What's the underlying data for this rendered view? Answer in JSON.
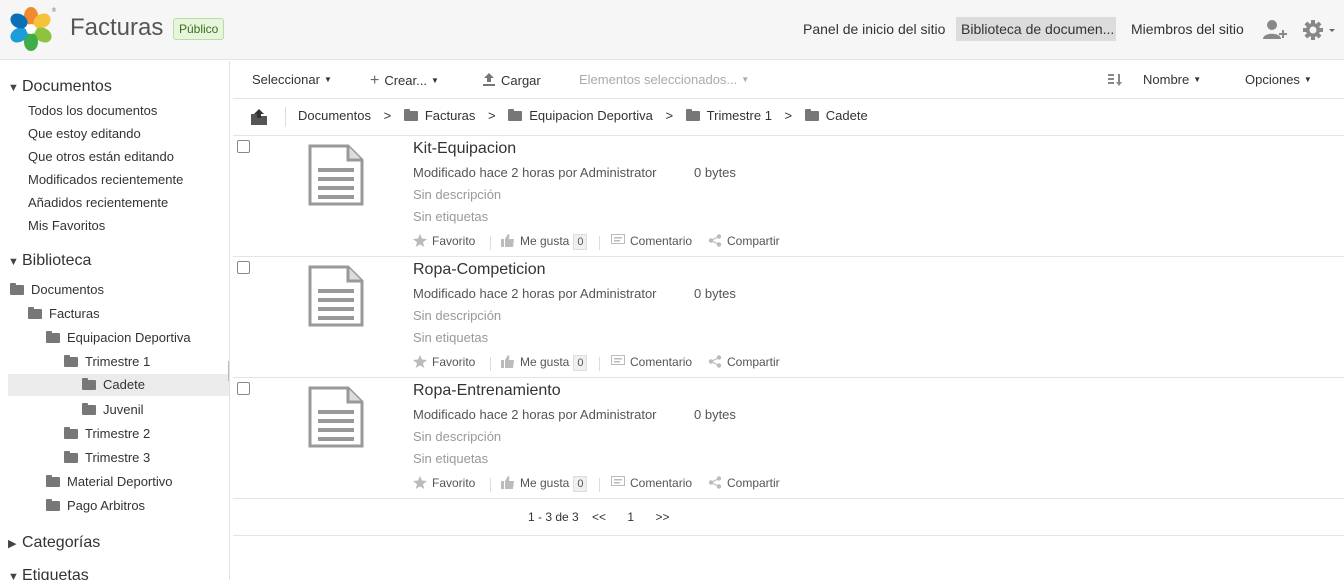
{
  "header": {
    "site_title": "Facturas",
    "visibility": "Público",
    "nav": {
      "dashboard": "Panel de inicio del sitio",
      "library": "Biblioteca de documen...",
      "members": "Miembros del sitio"
    },
    "icons": [
      "alfresco-logo-icon",
      "user-add-icon",
      "gear-icon"
    ]
  },
  "sidebar": {
    "documents_heading": "Documentos",
    "filters": [
      "Todos los documentos",
      "Que estoy editando",
      "Que otros están editando",
      "Modificados recientemente",
      "Añadidos recientemente",
      "Mis Favoritos"
    ],
    "library_heading": "Biblioteca",
    "tree": [
      {
        "label": "Documentos",
        "level": 0
      },
      {
        "label": "Facturas",
        "level": 1
      },
      {
        "label": "Equipacion Deportiva",
        "level": 2
      },
      {
        "label": "Trimestre 1",
        "level": 3
      },
      {
        "label": "Cadete",
        "level": 4,
        "selected": true
      },
      {
        "label": "Juvenil",
        "level": 4
      },
      {
        "label": "Trimestre 2",
        "level": 3
      },
      {
        "label": "Trimestre 3",
        "level": 3
      },
      {
        "label": "Material Deportivo",
        "level": 2
      },
      {
        "label": "Pago Arbitros",
        "level": 2
      }
    ],
    "categories_heading": "Categorías",
    "tags_heading": "Etiquetas"
  },
  "toolbar": {
    "select": "Seleccionar",
    "create": "Crear...",
    "upload": "Cargar",
    "selected_items": "Elementos seleccionados...",
    "sort": "Nombre",
    "options": "Opciones"
  },
  "breadcrumb": [
    "Documentos",
    "Facturas",
    "Equipacion Deportiva",
    "Trimestre 1",
    "Cadete"
  ],
  "documents": [
    {
      "name": "Kit-Equipacion",
      "modified": "Modificado hace 2 horas por Administrator",
      "size": "0 bytes",
      "description": "Sin descripción",
      "tags": "Sin etiquetas",
      "favorite": "Favorito",
      "like": "Me gusta",
      "like_count": "0",
      "comment": "Comentario",
      "share": "Compartir"
    },
    {
      "name": "Ropa-Competicion",
      "modified": "Modificado hace 2 horas por Administrator",
      "size": "0 bytes",
      "description": "Sin descripción",
      "tags": "Sin etiquetas",
      "favorite": "Favorito",
      "like": "Me gusta",
      "like_count": "0",
      "comment": "Comentario",
      "share": "Compartir"
    },
    {
      "name": "Ropa-Entrenamiento",
      "modified": "Modificado hace 2 horas por Administrator",
      "size": "0 bytes",
      "description": "Sin descripción",
      "tags": "Sin etiquetas",
      "favorite": "Favorito",
      "like": "Me gusta",
      "like_count": "0",
      "comment": "Comentario",
      "share": "Compartir"
    }
  ],
  "pagination": {
    "range": "1 - 3 de 3",
    "prev": "<<",
    "current_page": "1",
    "next": ">>"
  }
}
